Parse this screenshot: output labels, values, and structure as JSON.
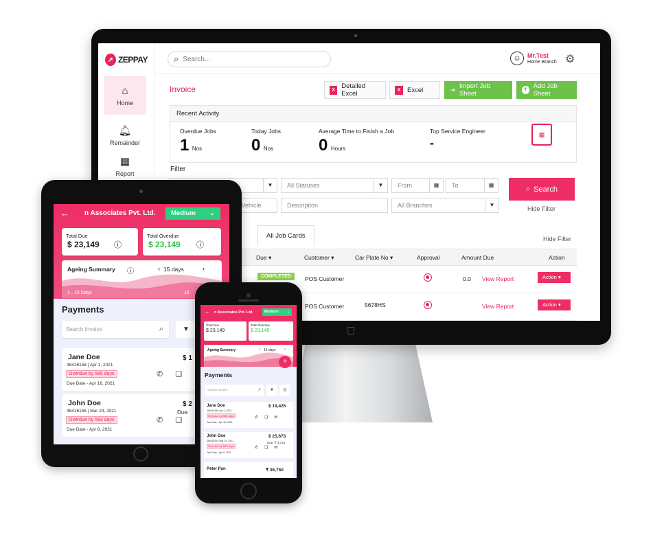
{
  "desktop": {
    "brand": "ZEPPAY",
    "search_placeholder": "Search...",
    "user": {
      "name": "Mr.Test",
      "branch": "Home Branch"
    },
    "nav": [
      {
        "label": "Home",
        "icon": "home-icon"
      },
      {
        "label": "Remainder",
        "icon": "bell-icon"
      },
      {
        "label": "Report",
        "icon": "report-icon"
      }
    ],
    "page_title": "Invoice",
    "buttons": {
      "detailed_excel": "Detailed Excel",
      "excel": "Excel",
      "import_job_sheet": "Import Job Sheet",
      "add_job_sheet": "Add Job Sheet"
    },
    "recent_activity": {
      "title": "Recent Activity",
      "stats": [
        {
          "label": "Overdue Jobs",
          "value": "1",
          "unit": "Nos"
        },
        {
          "label": "Today Jobs",
          "value": "0",
          "unit": "Nos"
        },
        {
          "label": "Average Time to Finish a Job",
          "value": "0",
          "unit": "Hours"
        },
        {
          "label": "Top Service Engineer",
          "value": "-",
          "unit": ""
        }
      ]
    },
    "filter": {
      "label": "Filter",
      "statuses_placeholder": "All Statuses",
      "from_placeholder": "From",
      "to_placeholder": "To",
      "vehicle_placeholder": "e/Vehicle",
      "description_placeholder": "Description",
      "branches_placeholder": "All Branches",
      "search_button": "Search",
      "hide_filter": "Hide Filter",
      "hide_filter_2": "Hide Filter"
    },
    "tabs": {
      "left_fragment": "d",
      "all_job_cards": "All Job Cards"
    },
    "table": {
      "headers": {
        "due": "Due",
        "customer": "Customer",
        "car_plate": "Car Plate No",
        "approval": "Approval",
        "amount_due": "Amount Due",
        "action": "Action"
      },
      "rows": [
        {
          "status": "COMPLETED",
          "customer": "POS Customer",
          "car_plate": "",
          "amount": "0.0",
          "link": "View Report",
          "action": "Action"
        },
        {
          "status": "",
          "customer": "POS Customer",
          "car_plate": "5678HS",
          "amount": "",
          "link": "View Report",
          "action": "Action"
        }
      ]
    },
    "colors": {
      "accent": "#ee2d65",
      "green": "#6dc24b"
    }
  },
  "tablet": {
    "company": "n Associates Pvt. Ltd.",
    "priority": "Medium",
    "total_due_label": "Total Due",
    "total_due": "$ 23,149",
    "total_overdue_label": "Total Overdue",
    "total_overdue": "$ 23,149",
    "ageing_title": "Ageing Summary",
    "ageing_days": "15 days",
    "ageing_range": "1 - 15 Days",
    "ageing_right": "16",
    "payments_title": "Payments",
    "search_placeholder": "Search Invoice",
    "items": [
      {
        "name": "Jane Doe",
        "id": "48416158",
        "date": "Apr 1, 2021",
        "overdue": "Overdue by 585 days",
        "due": "Due Date - Apr 16, 2021",
        "amount": "$ 1",
        "sub": ""
      },
      {
        "name": "John Doe",
        "id": "48416156",
        "date": "Mar 24, 2021",
        "overdue": "Overdue by 593 days",
        "due": "Due Date - Apr 8, 2021",
        "amount": "$ 2",
        "sub": "Due:"
      }
    ]
  },
  "phone": {
    "company": "n Associates Pvt. Ltd.",
    "priority": "Medium",
    "total_due_label": "Total Due",
    "total_due": "$ 23,149",
    "total_overdue_label": "Total Overdue",
    "total_overdue": "$ 23,149",
    "ageing_title": "Ageing Summary",
    "ageing_days": "15 days",
    "payments_title": "Payments",
    "search_placeholder": "Search Invoice",
    "items": [
      {
        "name": "Jane Doe",
        "id": "48416158",
        "date": "Apr 1, 2021",
        "overdue": "Overdue by 585 days",
        "due": "Due Date - Apr 16, 2021",
        "amount": "$ 19,425",
        "sub": ""
      },
      {
        "name": "John Doe",
        "id": "48416156",
        "date": "Mar 24, 2021",
        "overdue": "Overdue by 593 days",
        "due": "Due Date - Apr 8, 2021",
        "amount": "$ 25,673",
        "sub": "Due: ₹ 3,724"
      },
      {
        "name": "Peter Pan",
        "id": "",
        "date": "",
        "overdue": "",
        "due": "",
        "amount": "₹ 36,750",
        "sub": ""
      }
    ]
  }
}
